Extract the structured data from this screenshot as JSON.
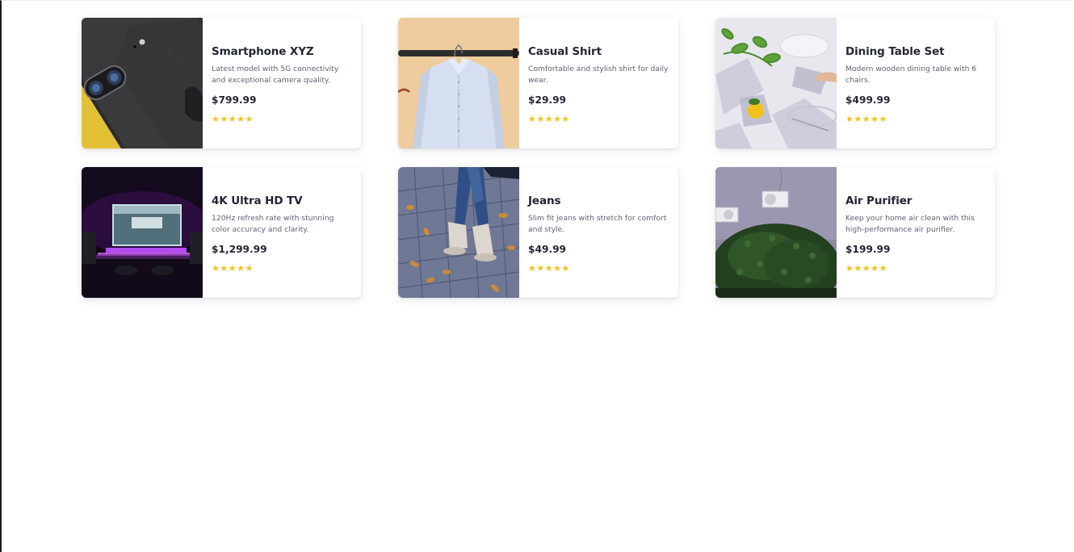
{
  "products": [
    {
      "name": "Smartphone XYZ",
      "description": "Latest model with 5G connectivity and exceptional camera quality.",
      "price": "$799.99",
      "rating_text": "★★★★★",
      "rating": 5,
      "image": "smartphone-photo"
    },
    {
      "name": "Casual Shirt",
      "description": "Comfortable and stylish shirt for daily wear.",
      "price": "$29.99",
      "rating_text": "★★★★★",
      "rating": 5,
      "image": "shirt-photo"
    },
    {
      "name": "Dining Table Set",
      "description": "Modern wooden dining table with 6 chairs.",
      "price": "$499.99",
      "rating_text": "★★★★★",
      "rating": 5,
      "image": "dining-table-photo"
    },
    {
      "name": "4K Ultra HD TV",
      "description": "120Hz refresh rate with stunning color accuracy and clarity.",
      "price": "$1,299.99",
      "rating_text": "★★★★★",
      "rating": 5,
      "image": "tv-photo"
    },
    {
      "name": "Jeans",
      "description": "Slim fit jeans with stretch for comfort and style.",
      "price": "$49.99",
      "rating_text": "★★★★★",
      "rating": 5,
      "image": "jeans-photo"
    },
    {
      "name": "Air Purifier",
      "description": "Keep your home air clean with this high-performance air purifier.",
      "price": "$199.99",
      "rating_text": "★★★★★",
      "rating": 5,
      "image": "air-purifier-photo"
    }
  ],
  "colors": {
    "star": "#f4c21c",
    "title": "#232733",
    "description": "#5d6372"
  }
}
